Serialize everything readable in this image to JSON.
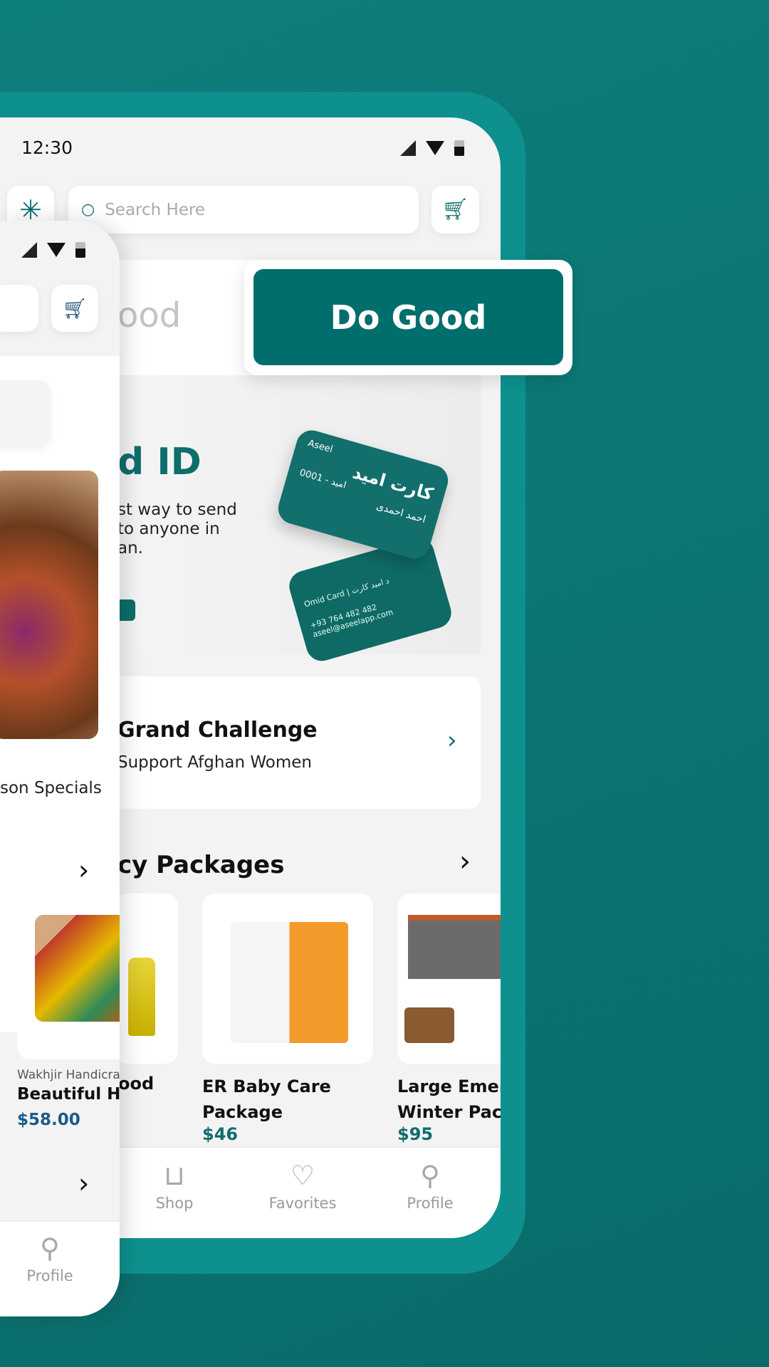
{
  "back_phone": {
    "status_time": "12:30",
    "search_placeholder": "Search Here",
    "tab_faded": "ood",
    "tab_active": "Do Good",
    "banner": {
      "title_partial": "d ID",
      "lines": [
        "st way to send",
        "to anyone in",
        "an."
      ],
      "card_brand": "Aseel",
      "card_title_ar": "کارت امید",
      "card_number": "0001 - امید",
      "card_name_ar": "احمد احمدی",
      "card_back_label": "Omid Card | د امید کارت",
      "card_back_phone": "+93 764 482 482",
      "card_back_email": "aseel@aseelapp.com"
    },
    "challenge": {
      "title": "Grand Challenge",
      "subtitle": "Support Afghan Women"
    },
    "section_title": "cy Packages",
    "products": [
      {
        "title": "ood",
        "price": ""
      },
      {
        "title": "ER Baby Care Package",
        "title_lines": [
          "ER Baby Care",
          "Package"
        ],
        "price": "$46"
      },
      {
        "title_lines": [
          "Large Emerg",
          "Winter Pack"
        ],
        "price": "$95"
      }
    ],
    "nav": [
      {
        "label": "Shop",
        "icon": "bag-icon"
      },
      {
        "label": "Favorites",
        "icon": "heart-icon"
      },
      {
        "label": "Profile",
        "icon": "person-icon"
      }
    ]
  },
  "front_phone": {
    "category_label": "son Specials",
    "product": {
      "vendor": "Wakhjir Handicra",
      "title": "Beautiful Ha",
      "price": "$58.00"
    },
    "nav": [
      {
        "label": "Profile",
        "icon": "person-icon"
      }
    ]
  },
  "colors": {
    "teal": "#0e6e6c",
    "price_blue": "#1a5a8a",
    "background": "#0b7472"
  }
}
